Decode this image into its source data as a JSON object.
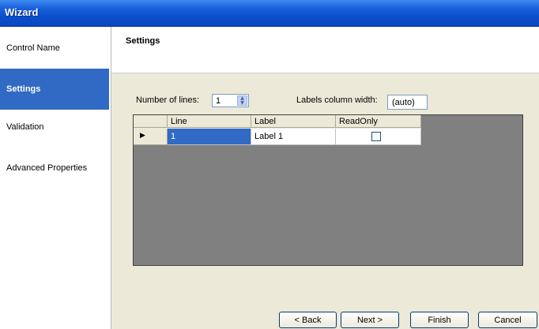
{
  "window": {
    "title": "Wizard"
  },
  "sidebar": {
    "items": [
      {
        "label": "Control Name",
        "selected": false
      },
      {
        "label": "Settings",
        "selected": true
      },
      {
        "label": "Validation",
        "selected": false
      },
      {
        "label": "Advanced Properties",
        "selected": false
      }
    ]
  },
  "content": {
    "title": "Settings",
    "number_of_lines_label": "Number of lines:",
    "number_of_lines_value": "1",
    "labels_width_label": "Labels column width:",
    "labels_width_value": "(auto)"
  },
  "grid": {
    "columns": [
      "Line",
      "Label",
      "ReadOnly"
    ],
    "rows": [
      {
        "line": "1",
        "label": "Label 1",
        "readonly": false
      }
    ]
  },
  "footer": {
    "back_label": "< Back",
    "next_label": "Next >",
    "finish_label": "Finish",
    "cancel_label": "Cancel"
  },
  "colors": {
    "titlebar": "#0b4fcc",
    "selection": "#316ac5",
    "panel": "#ece9d8",
    "grid_bg": "#808080"
  }
}
